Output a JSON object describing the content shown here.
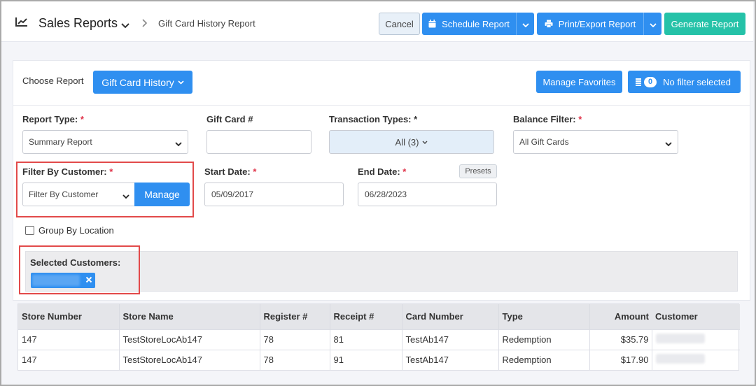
{
  "header": {
    "app_title": "Sales Reports",
    "breadcrumb": "Gift Card History Report",
    "cancel_label": "Cancel",
    "schedule_label": "Schedule Report",
    "print_label": "Print/Export Report",
    "generate_label": "Generate Report"
  },
  "toolbar": {
    "choose_report_label": "Choose Report",
    "report_selector": "Gift Card History",
    "manage_favorites_label": "Manage Favorites",
    "filter_count": "0",
    "filter_status": "No filter selected"
  },
  "form": {
    "report_type_label": "Report Type:",
    "report_type_value": "Summary Report",
    "gift_card_label": "Gift Card #",
    "gift_card_value": "",
    "transaction_types_label": "Transaction Types: *",
    "transaction_types_value": "All (3)",
    "balance_filter_label": "Balance Filter:",
    "balance_filter_value": "All Gift Cards",
    "filter_customer_label": "Filter By Customer:",
    "filter_customer_value": "Filter By Customer",
    "manage_label": "Manage",
    "start_date_label": "Start Date:",
    "start_date_value": "05/09/2017",
    "end_date_label": "End Date:",
    "end_date_value": "06/28/2023",
    "presets_label": "Presets",
    "group_by_location_label": "Group By Location",
    "group_by_location_checked": false,
    "selected_customers_label": "Selected Customers:",
    "required_mark": "*"
  },
  "table": {
    "columns": [
      "Store Number",
      "Store Name",
      "Register #",
      "Receipt #",
      "Card Number",
      "Type",
      "Amount",
      "Customer"
    ],
    "rows": [
      {
        "store_number": "147",
        "store_name": "TestStoreLocAb147",
        "register": "78",
        "receipt": "81",
        "card_number": "TestAb147",
        "type": "Redemption",
        "amount": "$35.79"
      },
      {
        "store_number": "147",
        "store_name": "TestStoreLocAb147",
        "register": "78",
        "receipt": "91",
        "card_number": "TestAb147",
        "type": "Redemption",
        "amount": "$17.90"
      }
    ]
  },
  "colors": {
    "primary": "#2f8ff0",
    "success": "#25c2a8",
    "highlight": "#e24a4a",
    "required": "#e0344a"
  }
}
